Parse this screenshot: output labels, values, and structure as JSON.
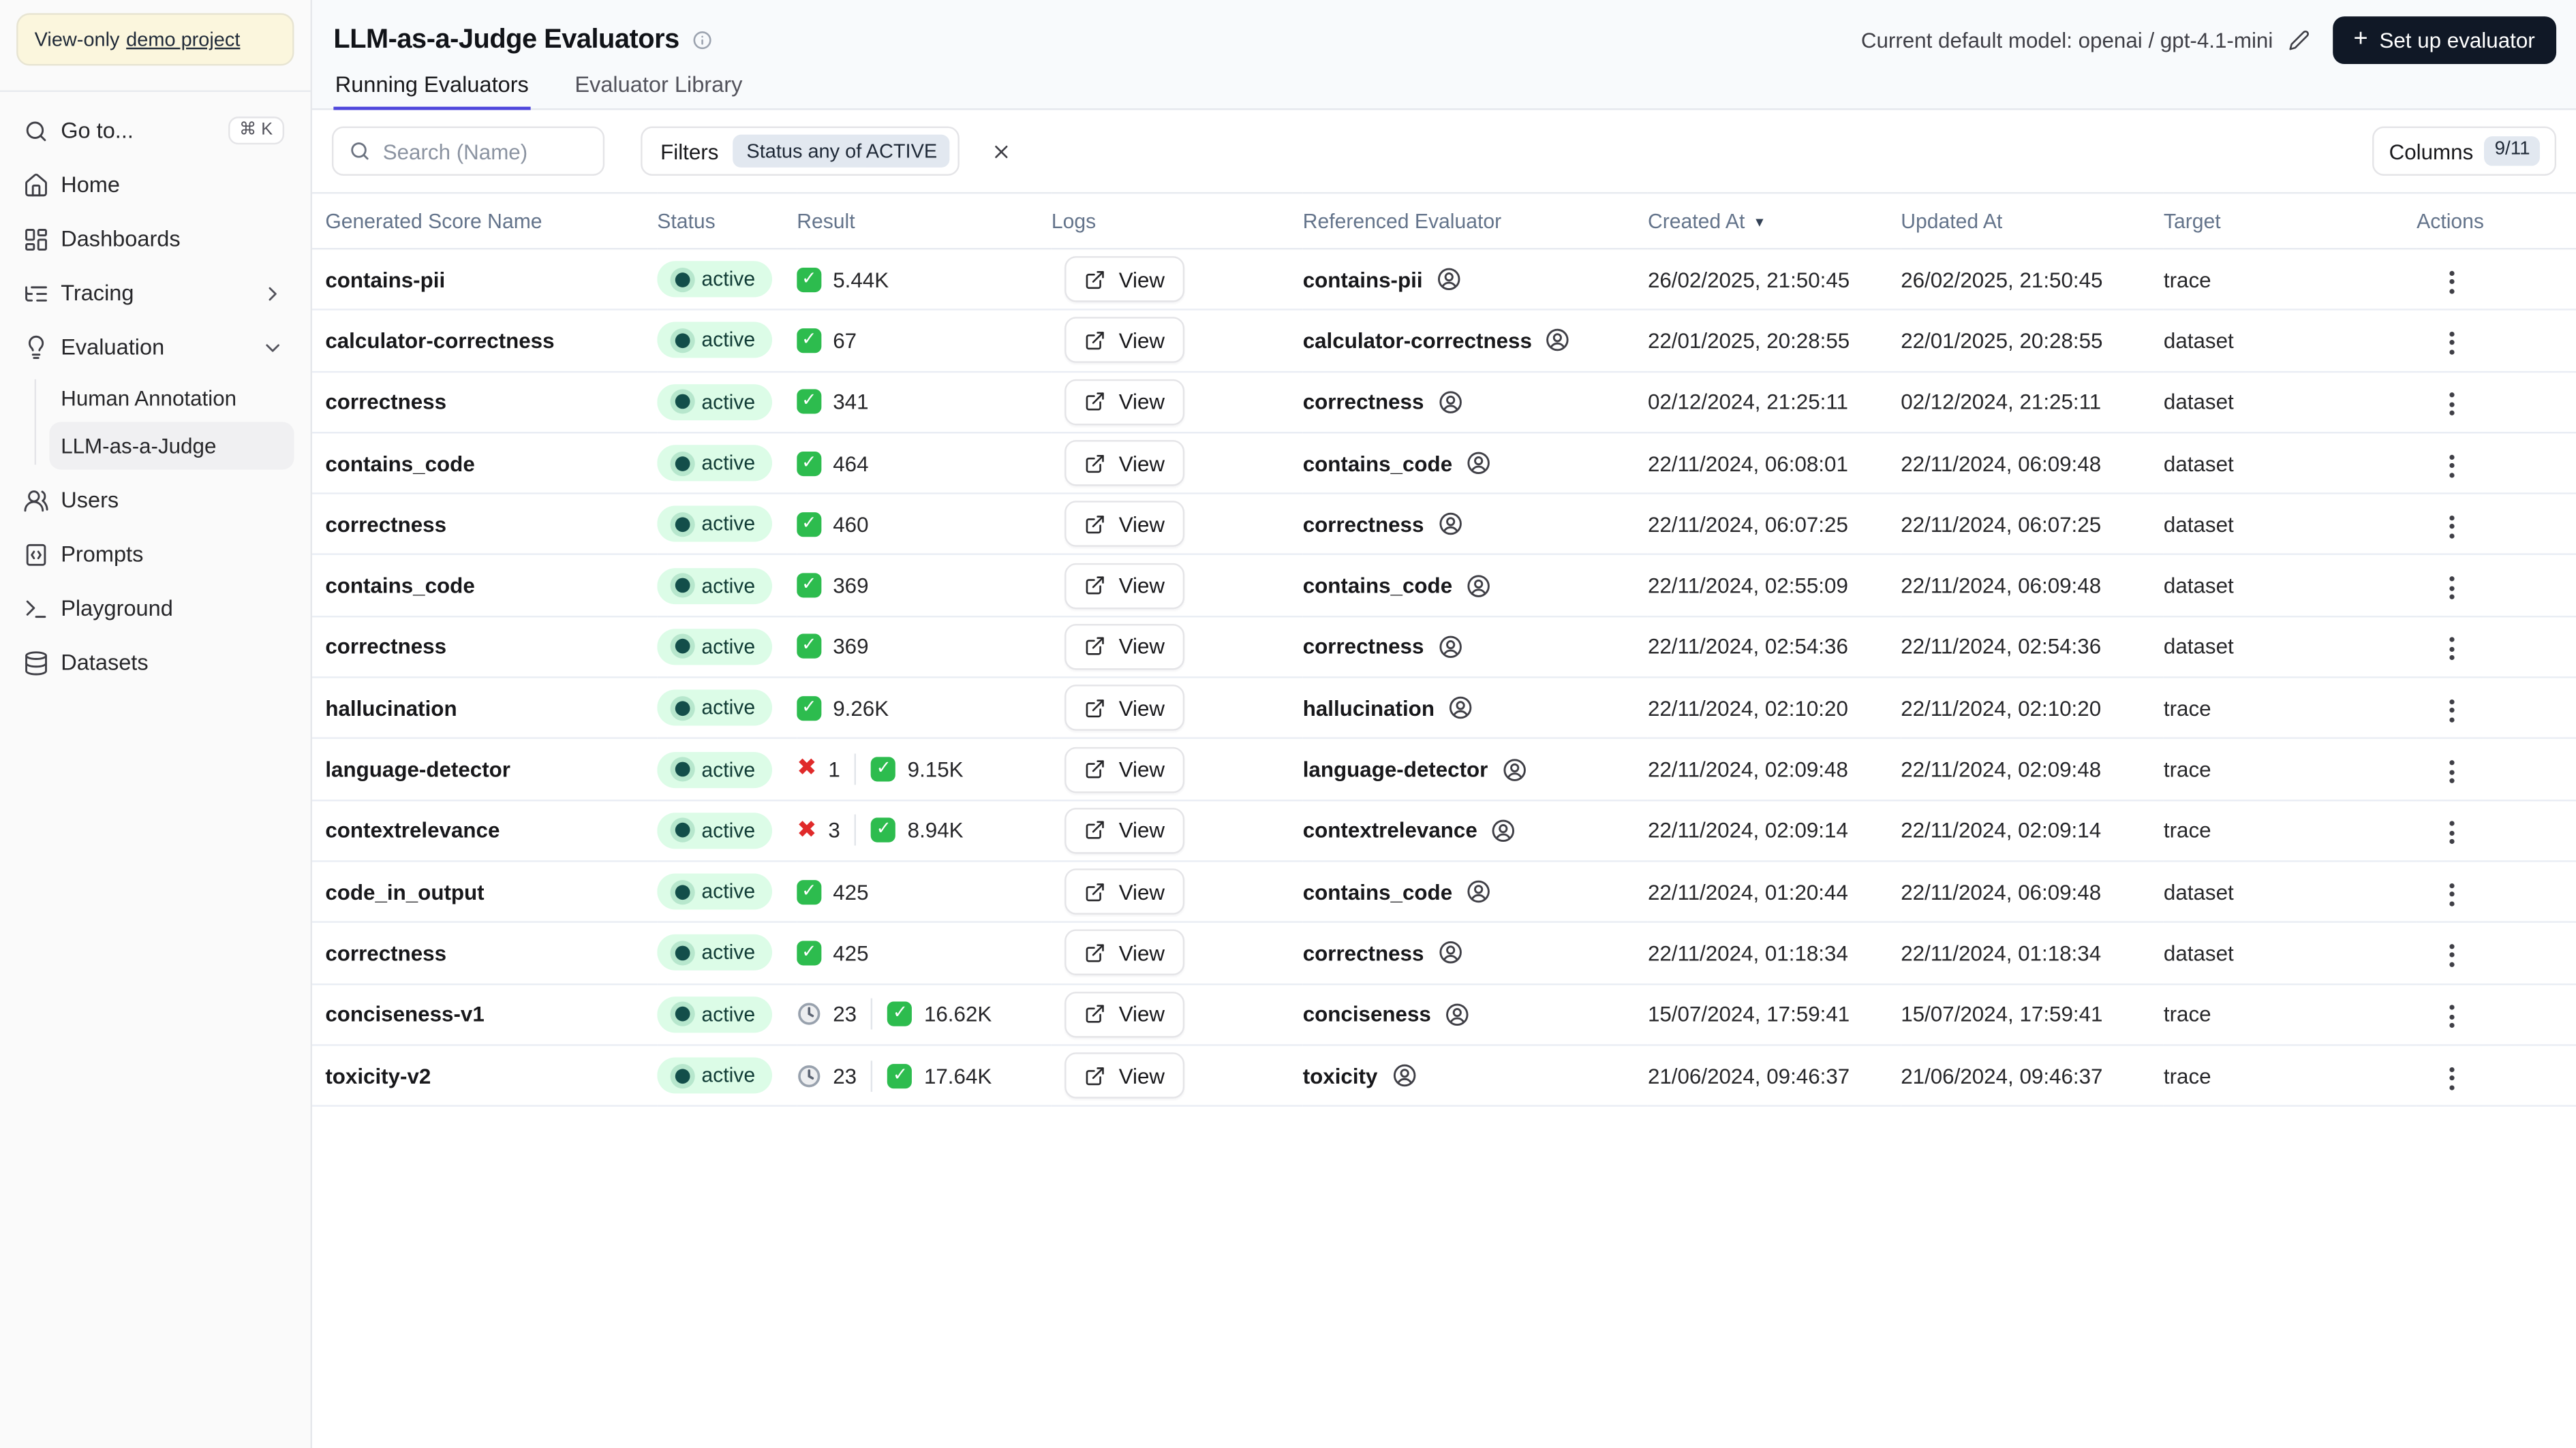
{
  "app": {
    "sidebar": {
      "banner_prefix": "View-only",
      "banner_link": "demo project",
      "nav": [
        {
          "label": "Go to...",
          "icon": "search-icon",
          "shortcut": "⌘ K"
        },
        {
          "label": "Home",
          "icon": "home-icon"
        },
        {
          "label": "Dashboards",
          "icon": "dashboard-icon"
        },
        {
          "label": "Tracing",
          "icon": "trace-tree-icon",
          "chevron": "right"
        },
        {
          "label": "Evaluation",
          "icon": "lightbulb-icon",
          "chevron": "down",
          "expanded": true,
          "children": [
            {
              "label": "Human Annotation",
              "active": false
            },
            {
              "label": "LLM-as-a-Judge",
              "active": true
            }
          ]
        },
        {
          "label": "Users",
          "icon": "users-icon"
        },
        {
          "label": "Prompts",
          "icon": "prompts-icon"
        },
        {
          "label": "Playground",
          "icon": "terminal-icon"
        },
        {
          "label": "Datasets",
          "icon": "database-icon"
        }
      ]
    },
    "header": {
      "title": "LLM-as-a-Judge Evaluators",
      "default_model_label": "Current default model: openai / gpt-4.1-mini",
      "setup_button_label": "Set up evaluator",
      "tabs": [
        {
          "label": "Running Evaluators",
          "active": true
        },
        {
          "label": "Evaluator Library",
          "active": false
        }
      ]
    },
    "toolbar": {
      "search_placeholder": "Search (Name)",
      "filters_label": "Filters",
      "filter_chip": "Status any of ACTIVE",
      "columns_label": "Columns",
      "columns_badge": "9/11"
    },
    "table": {
      "columns": [
        {
          "label": "Generated Score Name"
        },
        {
          "label": "Status"
        },
        {
          "label": "Result"
        },
        {
          "label": "Logs"
        },
        {
          "label": "Referenced Evaluator"
        },
        {
          "label": "Created At",
          "sort": "desc"
        },
        {
          "label": "Updated At"
        },
        {
          "label": "Target"
        },
        {
          "label": "Actions"
        }
      ],
      "rows": [
        {
          "name": "contains-pii",
          "status": "active",
          "result": [
            {
              "icon": "check",
              "value": "5.44K"
            }
          ],
          "logs": "View",
          "evaluator": "contains-pii",
          "created": "26/02/2025, 21:50:45",
          "updated": "26/02/2025, 21:50:45",
          "target": "trace"
        },
        {
          "name": "calculator-correctness",
          "status": "active",
          "result": [
            {
              "icon": "check",
              "value": "67"
            }
          ],
          "logs": "View",
          "evaluator": "calculator-correctness",
          "created": "22/01/2025, 20:28:55",
          "updated": "22/01/2025, 20:28:55",
          "target": "dataset"
        },
        {
          "name": "correctness",
          "status": "active",
          "result": [
            {
              "icon": "check",
              "value": "341"
            }
          ],
          "logs": "View",
          "evaluator": "correctness",
          "created": "02/12/2024, 21:25:11",
          "updated": "02/12/2024, 21:25:11",
          "target": "dataset"
        },
        {
          "name": "contains_code",
          "status": "active",
          "result": [
            {
              "icon": "check",
              "value": "464"
            }
          ],
          "logs": "View",
          "evaluator": "contains_code",
          "created": "22/11/2024, 06:08:01",
          "updated": "22/11/2024, 06:09:48",
          "target": "dataset"
        },
        {
          "name": "correctness",
          "status": "active",
          "result": [
            {
              "icon": "check",
              "value": "460"
            }
          ],
          "logs": "View",
          "evaluator": "correctness",
          "created": "22/11/2024, 06:07:25",
          "updated": "22/11/2024, 06:07:25",
          "target": "dataset"
        },
        {
          "name": "contains_code",
          "status": "active",
          "result": [
            {
              "icon": "check",
              "value": "369"
            }
          ],
          "logs": "View",
          "evaluator": "contains_code",
          "created": "22/11/2024, 02:55:09",
          "updated": "22/11/2024, 06:09:48",
          "target": "dataset"
        },
        {
          "name": "correctness",
          "status": "active",
          "result": [
            {
              "icon": "check",
              "value": "369"
            }
          ],
          "logs": "View",
          "evaluator": "correctness",
          "created": "22/11/2024, 02:54:36",
          "updated": "22/11/2024, 02:54:36",
          "target": "dataset"
        },
        {
          "name": "hallucination",
          "status": "active",
          "result": [
            {
              "icon": "check",
              "value": "9.26K"
            }
          ],
          "logs": "View",
          "evaluator": "hallucination",
          "created": "22/11/2024, 02:10:20",
          "updated": "22/11/2024, 02:10:20",
          "target": "trace"
        },
        {
          "name": "language-detector",
          "status": "active",
          "result": [
            {
              "icon": "x",
              "value": "1"
            },
            {
              "icon": "check",
              "value": "9.15K"
            }
          ],
          "logs": "View",
          "evaluator": "language-detector",
          "created": "22/11/2024, 02:09:48",
          "updated": "22/11/2024, 02:09:48",
          "target": "trace"
        },
        {
          "name": "contextrelevance",
          "status": "active",
          "result": [
            {
              "icon": "x",
              "value": "3"
            },
            {
              "icon": "check",
              "value": "8.94K"
            }
          ],
          "logs": "View",
          "evaluator": "contextrelevance",
          "created": "22/11/2024, 02:09:14",
          "updated": "22/11/2024, 02:09:14",
          "target": "trace"
        },
        {
          "name": "code_in_output",
          "status": "active",
          "result": [
            {
              "icon": "check",
              "value": "425"
            }
          ],
          "logs": "View",
          "evaluator": "contains_code",
          "created": "22/11/2024, 01:20:44",
          "updated": "22/11/2024, 06:09:48",
          "target": "dataset"
        },
        {
          "name": "correctness",
          "status": "active",
          "result": [
            {
              "icon": "check",
              "value": "425"
            }
          ],
          "logs": "View",
          "evaluator": "correctness",
          "created": "22/11/2024, 01:18:34",
          "updated": "22/11/2024, 01:18:34",
          "target": "dataset"
        },
        {
          "name": "conciseness-v1",
          "status": "active",
          "result": [
            {
              "icon": "clock",
              "value": "23"
            },
            {
              "icon": "check",
              "value": "16.62K"
            }
          ],
          "logs": "View",
          "evaluator": "conciseness",
          "created": "15/07/2024, 17:59:41",
          "updated": "15/07/2024, 17:59:41",
          "target": "trace"
        },
        {
          "name": "toxicity-v2",
          "status": "active",
          "result": [
            {
              "icon": "clock",
              "value": "23"
            },
            {
              "icon": "check",
              "value": "17.64K"
            }
          ],
          "logs": "View",
          "evaluator": "toxicity",
          "created": "21/06/2024, 09:46:37",
          "updated": "21/06/2024, 09:46:37",
          "target": "trace"
        }
      ]
    },
    "colors": {
      "accent": "#4e46dc",
      "status_badge_bg": "#dcfce7",
      "status_dot": "#134e4a",
      "check_green": "#2dbc4e",
      "cross_red": "#e02a2a",
      "primary_button_bg": "#101826",
      "header_bg": "#f8fafc"
    }
  }
}
